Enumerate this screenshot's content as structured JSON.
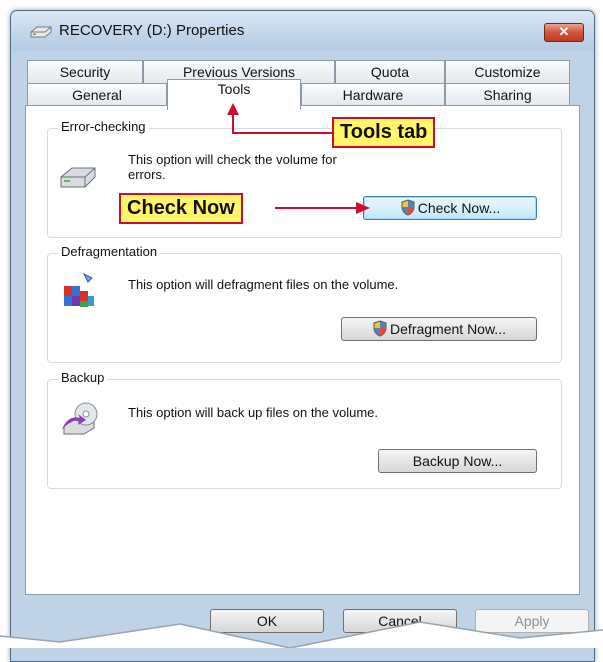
{
  "window": {
    "title": "RECOVERY (D:) Properties",
    "close_label": "✕"
  },
  "tabs_row1": [
    "Security",
    "Previous Versions",
    "Quota",
    "Customize"
  ],
  "tabs_row2": [
    "General",
    "Tools",
    "Hardware",
    "Sharing"
  ],
  "error_checking": {
    "title": "Error-checking",
    "description_line1": "This option will check the volume for",
    "description_line2": "errors.",
    "button": "Check Now..."
  },
  "defragmentation": {
    "title": "Defragmentation",
    "description": "This option will defragment files on the volume.",
    "button": "Defragment Now..."
  },
  "backup": {
    "title": "Backup",
    "description": "This option will back up files on the volume.",
    "button": "Backup Now..."
  },
  "footer": {
    "ok": "OK",
    "cancel": "Cancel",
    "apply": "Apply"
  },
  "annotations": {
    "tools_tab": "Tools tab",
    "check_now": "Check Now"
  },
  "colors": {
    "callout_fill": "#fff66a",
    "callout_border": "#c8102e",
    "window_frame": "#bfd2e6"
  }
}
